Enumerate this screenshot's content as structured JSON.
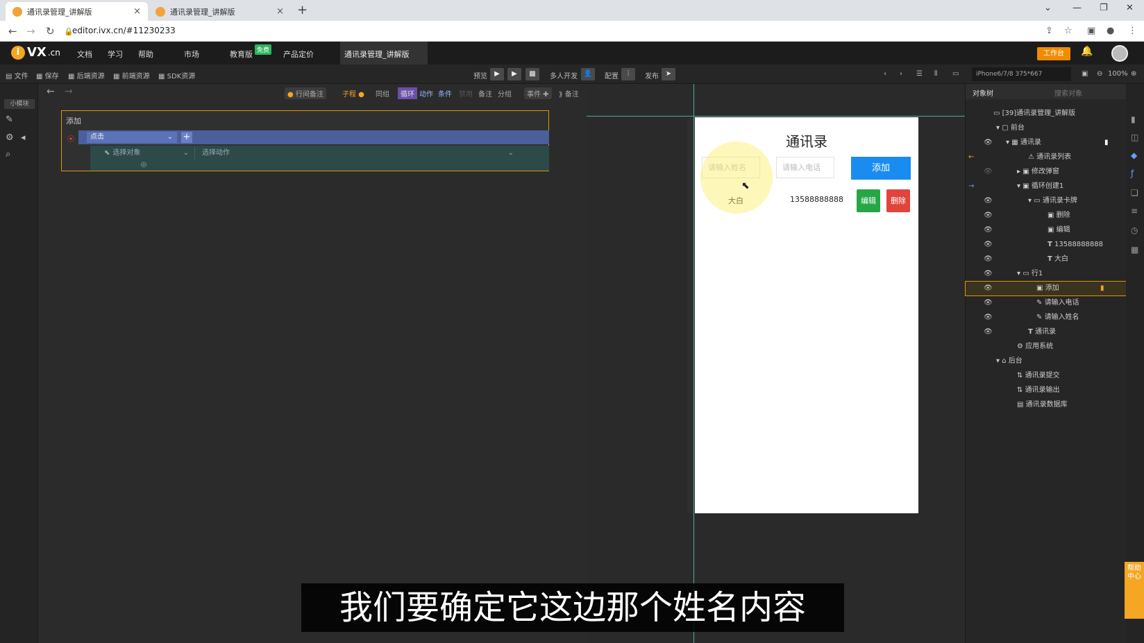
{
  "browser": {
    "tabs": [
      {
        "title": "通讯录管理_讲解版",
        "close": "×"
      },
      {
        "title": "通讯录管理_讲解版",
        "close": "×"
      }
    ],
    "new_tab": "+",
    "url": "editor.ivx.cn/#11230233"
  },
  "app": {
    "logo_main": "VX",
    "logo_suffix": ".cn",
    "menu": [
      "文档",
      "学习",
      "帮助",
      "市场",
      "教育版",
      "产品定价"
    ],
    "free_badge": "免费",
    "project_tab": "通讯录管理_讲解版",
    "workbench": "工作台"
  },
  "toolbar": {
    "left": [
      "文件",
      "保存",
      "后端资源",
      "前端资源",
      "SDK资源"
    ],
    "preview": "预览",
    "multi_dev": "多人开发",
    "config": "配置",
    "publish": "发布",
    "device": "iPhone6/7/8 375*667",
    "zoom": "100%"
  },
  "leftrail": {
    "small_module": "小模块"
  },
  "event_tools": {
    "row_note": "行间备注",
    "sub": "子程",
    "sync": "同组",
    "loop": "循环",
    "action": "动作",
    "condition": "条件",
    "ban": "禁用",
    "note": "备注",
    "group": "分组",
    "event": "事件",
    "annot": "备注"
  },
  "event_block": {
    "title": "添加",
    "trigger": "点击",
    "select_object": "选择对象",
    "select_action": "选择动作"
  },
  "phone": {
    "title": "通讯录",
    "name_placeholder": "请输入姓名",
    "phone_placeholder": "请输入电话",
    "add_button": "添加",
    "contact_name": "大白",
    "contact_phone": "13588888888",
    "edit_button": "编辑",
    "delete_button": "删除"
  },
  "tree": {
    "tab_objects": "对象树",
    "search": "搜索对象",
    "items": [
      {
        "label": "[39]通讯录管理_讲解版"
      },
      {
        "label": "前台"
      },
      {
        "label": "通讯录"
      },
      {
        "label": "通讯录列表"
      },
      {
        "label": "修改弹窗"
      },
      {
        "label": "循环创建1"
      },
      {
        "label": "通讯录卡牌"
      },
      {
        "label": "删除"
      },
      {
        "label": "编辑"
      },
      {
        "label": "13588888888"
      },
      {
        "label": "大白"
      },
      {
        "label": "行1"
      },
      {
        "label": "添加"
      },
      {
        "label": "请输入电话"
      },
      {
        "label": "请输入姓名"
      },
      {
        "label": "通讯录"
      },
      {
        "label": "应用系统"
      },
      {
        "label": "后台"
      },
      {
        "label": "通讯录提交"
      },
      {
        "label": "通讯录输出"
      },
      {
        "label": "通讯录数据库"
      }
    ]
  },
  "help_tab": "帮助中心",
  "subtitle": "我们要确定它这边那个姓名内容"
}
